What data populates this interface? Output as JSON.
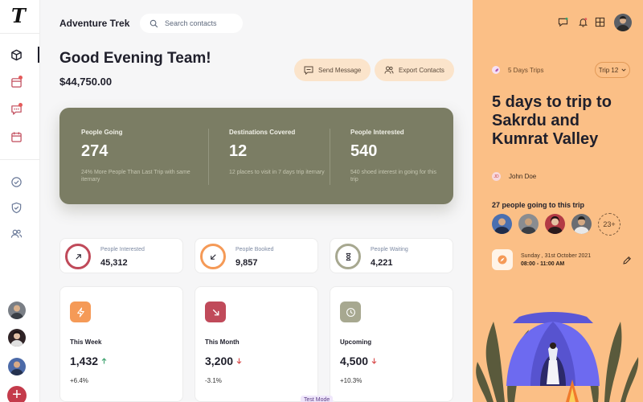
{
  "app": {
    "logo_letter": "T",
    "brand": "Adventure Trek"
  },
  "search": {
    "placeholder": "Search contacts"
  },
  "header": {
    "greeting": "Good Evening Team!",
    "amount": "$44,750.00",
    "send_message_label": "Send Message",
    "export_contacts_label": "Export Contacts"
  },
  "hero": {
    "stats": [
      {
        "label": "People Going",
        "value": "274",
        "sub": "24% More People Than Last Trip with same iternary"
      },
      {
        "label": "Destinations Covered",
        "value": "12",
        "sub": "12 places to visit in 7 days trip iternary"
      },
      {
        "label": "People Interested",
        "value": "540",
        "sub": "540 shoed interest in going for this trip"
      }
    ]
  },
  "stats_row": [
    {
      "label": "People Interested",
      "value": "45,312",
      "color": "#c04a5a",
      "icon": "arrow-up-right-icon"
    },
    {
      "label": "People Booked",
      "value": "9,857",
      "color": "#f59a57",
      "icon": "arrow-down-left-icon"
    },
    {
      "label": "People Waiting",
      "value": "4,221",
      "color": "#a7a890",
      "icon": "hourglass-icon"
    }
  ],
  "cards": [
    {
      "title": "This Week",
      "value": "1,432",
      "trend": "up",
      "percent": "+6.4%",
      "color": "#f59a57",
      "icon": "bolt-icon"
    },
    {
      "title": "This Month",
      "value": "3,200",
      "trend": "down",
      "percent": "-3.1%",
      "color": "#c04a5a",
      "icon": "arrow-down-left-icon"
    },
    {
      "title": "Upcoming",
      "value": "4,500",
      "trend": "down",
      "percent": "+10.3%",
      "color": "#a7a890",
      "icon": "clock-icon"
    }
  ],
  "footer": {
    "test_mode": "Test Mode"
  },
  "trip": {
    "label": "5 Days Trips",
    "selector": "Trip 12",
    "title": "5 days to trip to Sakrdu and Kumrat Valley",
    "author_initials": "JD",
    "author": "John Doe",
    "going_text": "27 people going to this trip",
    "more_count": "23+",
    "date": "Sunday , 31st October 2021",
    "time": "08:00 - 11:00 AM"
  },
  "colors": {
    "accent_panel": "#fbbf86",
    "hero_bg": "#7b7d64",
    "danger": "#c43b4b",
    "up": "#3aa06b",
    "down": "#d84a4a"
  }
}
